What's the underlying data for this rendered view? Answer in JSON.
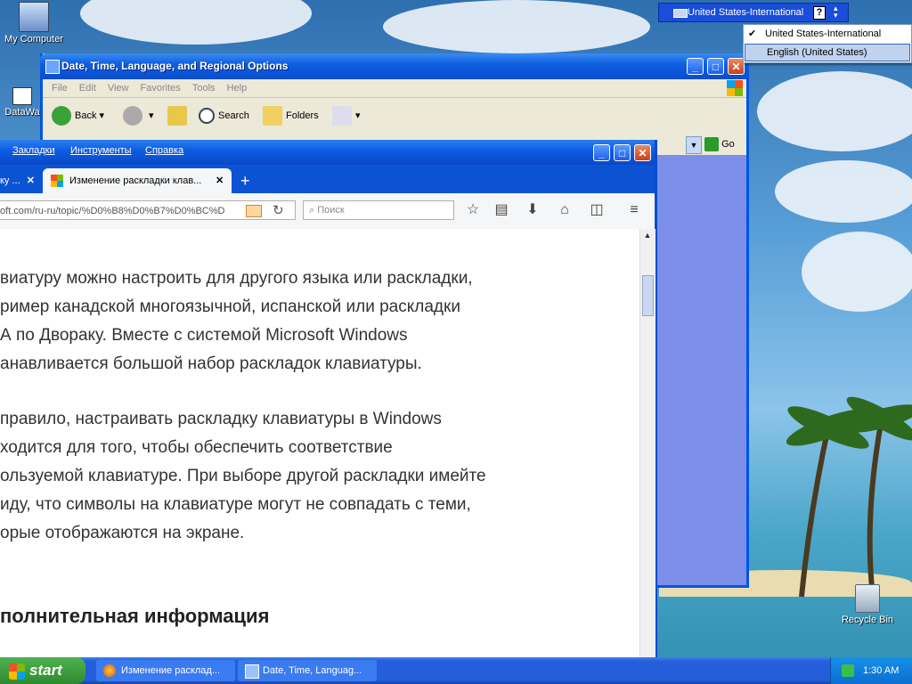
{
  "desktop": {
    "icons": [
      {
        "label": "My Computer"
      },
      {
        "label": "DataWa"
      },
      {
        "label": "Recycle Bin"
      }
    ]
  },
  "language_bar": {
    "current": "United States-International",
    "help_glyph": "?"
  },
  "language_menu": {
    "items": [
      {
        "label": "United States-International",
        "checked": true
      },
      {
        "label": "English (United States)",
        "highlighted": true
      }
    ]
  },
  "explorer_window": {
    "title": "Date, Time, Language, and Regional Options",
    "menu": [
      "File",
      "Edit",
      "View",
      "Favorites",
      "Tools",
      "Help"
    ],
    "toolbar": {
      "back": "Back",
      "search": "Search",
      "folders": "Folders",
      "go": "Go"
    }
  },
  "browser_window": {
    "menu": [
      "Закладки",
      "Инструменты",
      "Справка"
    ],
    "tabs": [
      {
        "label": "ку ..."
      },
      {
        "label": "Изменение раскладки клав..."
      }
    ],
    "new_tab": "+",
    "url": "oft.com/ru-ru/topic/%D0%B8%D0%B7%D0%BC%D",
    "search_placeholder": "Поиск",
    "content": {
      "para1": [
        "виатуру можно настроить для другого языка или раскладки,",
        "ример канадской многоязычной, испанской или раскладки",
        "А по Двораку. Вместе с системой Microsoft Windows",
        "анавливается большой набор раскладок клавиатуры."
      ],
      "para2": [
        "правило, настраивать раскладку клавиатуры в Windows",
        "ходится для того, чтобы обеспечить соответствие",
        "ользуемой клавиатуре. При выборе другой раскладки имейте",
        "иду, что символы на клавиатуре могут не совпадать с теми,",
        "орые отображаются на экране."
      ],
      "heading": "полнительная информация"
    }
  },
  "taskbar": {
    "start": "start",
    "items": [
      {
        "label": "Изменение расклад..."
      },
      {
        "label": "Date, Time, Languag..."
      }
    ],
    "clock": "1:30 AM"
  },
  "colors": {
    "xp_blue": "#0a4cd0",
    "start_green": "#2f8a2f",
    "menu_highlight": "#c1d2ee"
  }
}
